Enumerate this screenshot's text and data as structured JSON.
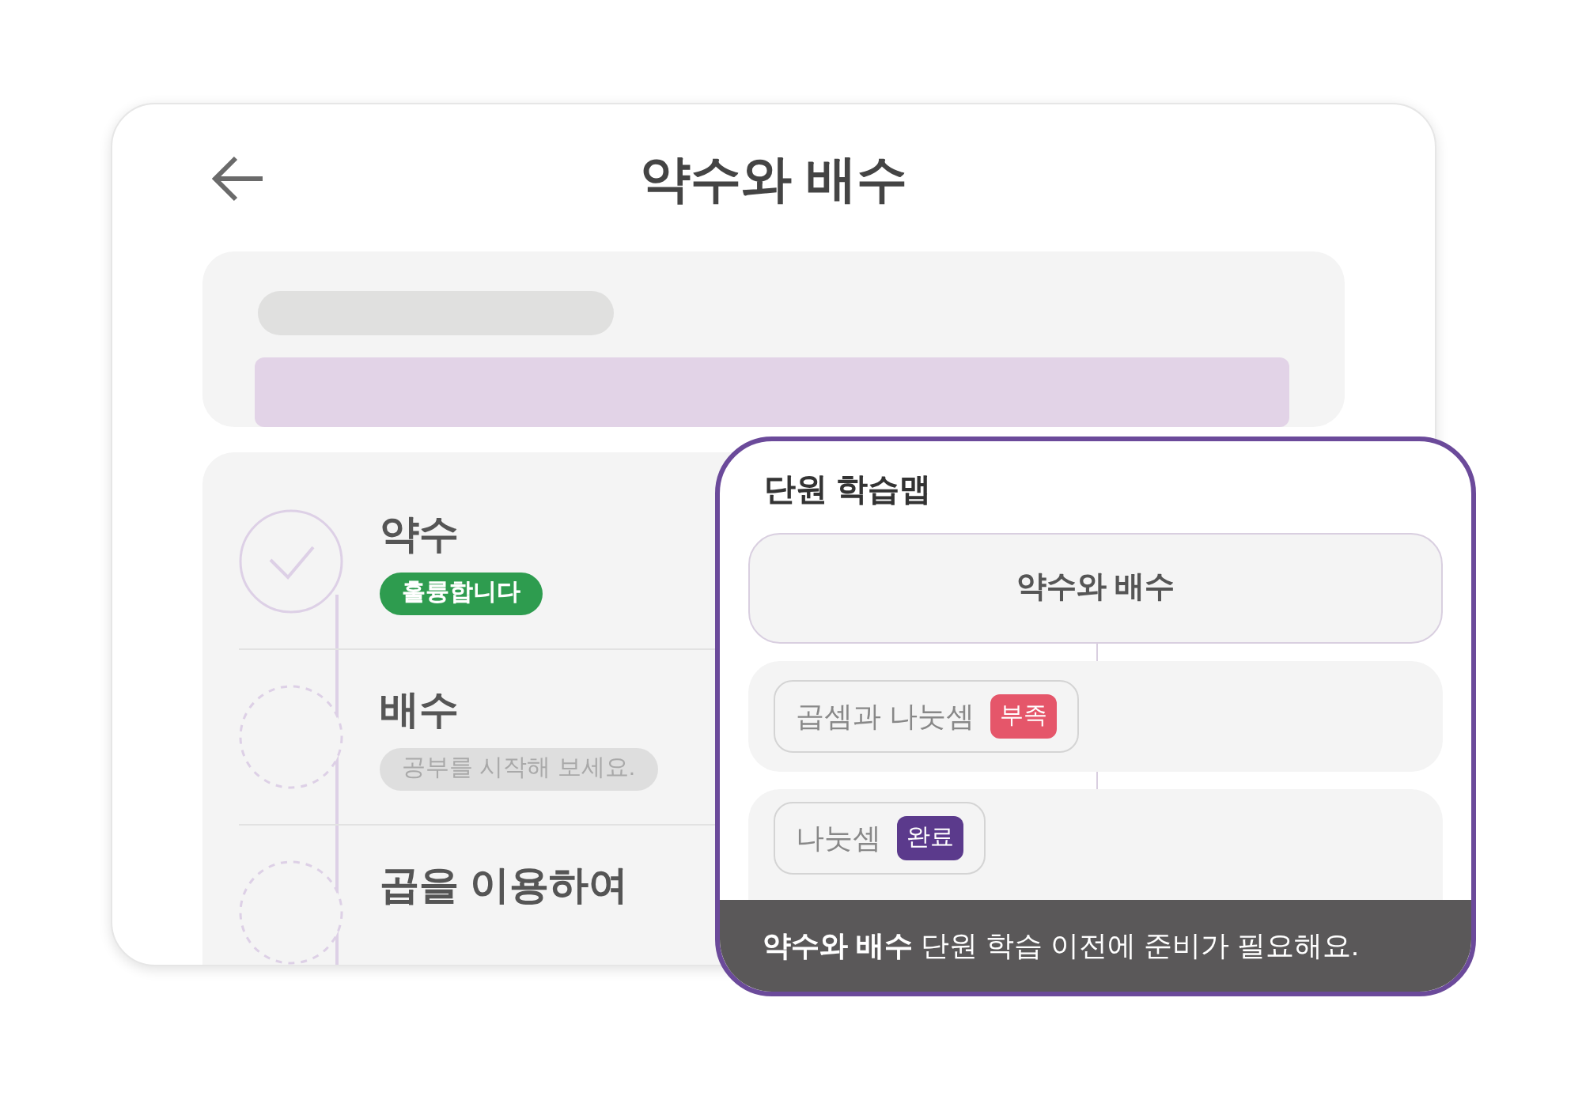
{
  "header": {
    "title": "약수와 배수"
  },
  "lessons": [
    {
      "title": "약수",
      "completed": true,
      "badge": "훌륭합니다"
    },
    {
      "title": "배수",
      "completed": false,
      "badge": "공부를 시작해 보세요."
    },
    {
      "title": "곱을 이용하여",
      "completed": false
    }
  ],
  "study_map": {
    "title": "단원 학습맵",
    "root": "약수와 배수",
    "nodes": [
      {
        "label": "곱셈과 나눗셈",
        "badge": "부족",
        "kind": "weak"
      },
      {
        "label": "나눗셈",
        "badge": "완료",
        "kind": "done"
      }
    ],
    "notice": "**약수와 배수** 단원 학습 이전에 준비가 필요해요."
  }
}
